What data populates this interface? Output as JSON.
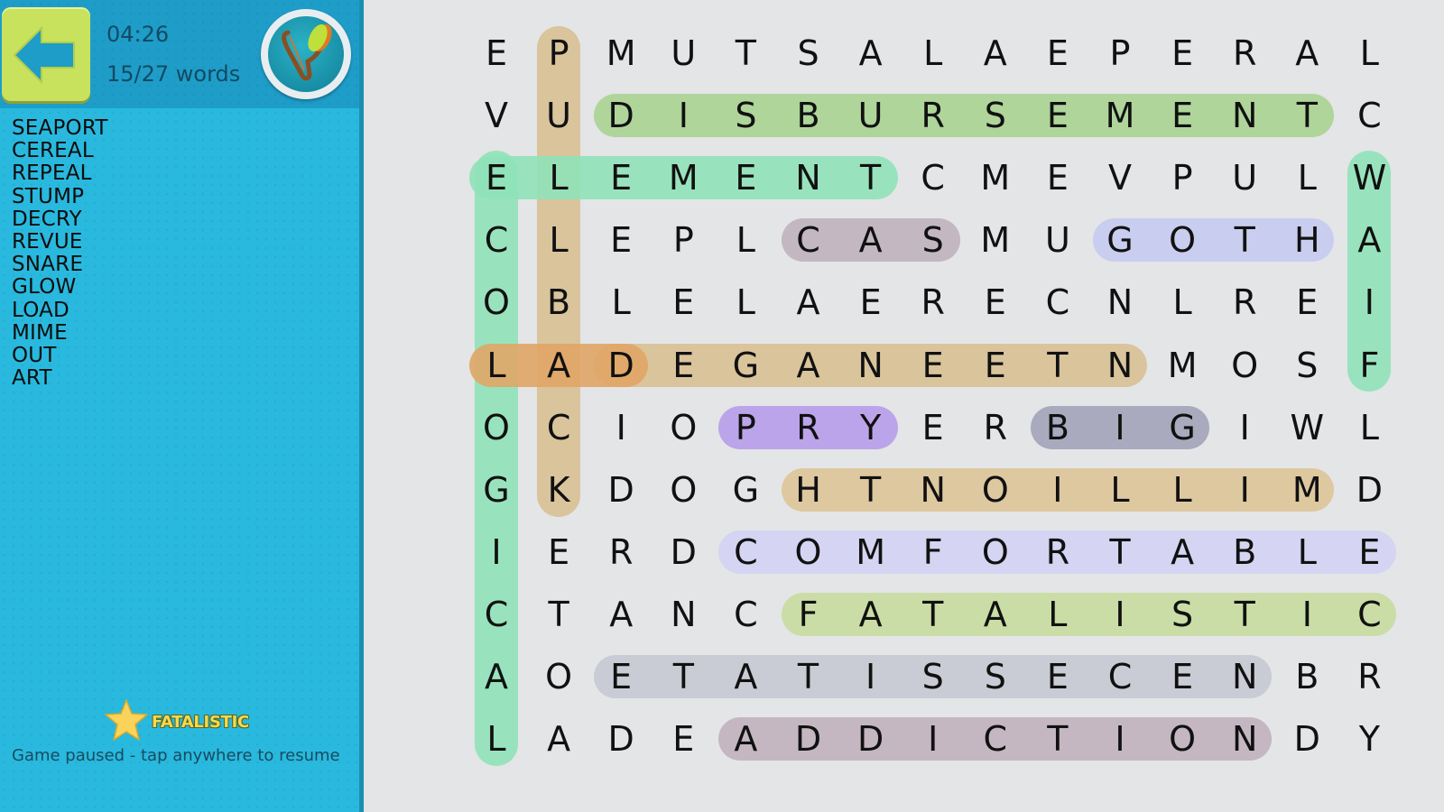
{
  "header": {
    "back_label": "Back",
    "timer": "04:26",
    "progress": "15/27 words",
    "badge_icon": "yoyo-icon"
  },
  "word_list": [
    "SEAPORT",
    "CEREAL",
    "REPEAL",
    "STUMP",
    "DECRY",
    "REVUE",
    "SNARE",
    "GLOW",
    "LOAD",
    "MIME",
    "OUT",
    "ART"
  ],
  "last_found": {
    "icon": "star-icon",
    "word": "FATALISTIC"
  },
  "status": "Game paused - tap anywhere to resume",
  "grid": [
    "EPMUTSALAEPERAL",
    "VUDISBURSEMENTC",
    "ELEMENTCMEVPULW",
    "CLEPLCASMUGOTHA",
    "OBLELAERECNLREI",
    "LADEGANEETNMOSF",
    "OCIOPRYERBIGIWL",
    "GKDOGHTNOILLIMD",
    "IERDCOMFORTABLE",
    "CTANCFATALISTIC",
    "AOETATISSECENBR",
    "LADEADDICTIONDY"
  ],
  "found": [
    {
      "word": "PULLBACK",
      "dir": "v",
      "col": 1,
      "start": 0,
      "end": 7,
      "color": "#d8c094"
    },
    {
      "word": "DISBURSEMENT",
      "dir": "h",
      "row": 1,
      "start": 2,
      "end": 13,
      "color": "#a8d391"
    },
    {
      "word": "ECOLOGICAL",
      "dir": "v",
      "col": 0,
      "start": 2,
      "end": 11,
      "color": "#8fe2b8"
    },
    {
      "word": "ELEMENT",
      "dir": "h",
      "row": 2,
      "start": 0,
      "end": 6,
      "color": "#8fe2b8"
    },
    {
      "word": "WAIF",
      "dir": "v",
      "col": 14,
      "start": 2,
      "end": 5,
      "color": "#8fe2b8"
    },
    {
      "word": "SAC",
      "dir": "h",
      "row": 3,
      "start": 5,
      "end": 7,
      "color": "#bfb1bd"
    },
    {
      "word": "GOTH",
      "dir": "h",
      "row": 3,
      "start": 10,
      "end": 13,
      "color": "#c5caef"
    },
    {
      "word": "TEENAGED",
      "dir": "h",
      "row": 5,
      "start": 2,
      "end": 10,
      "color": "#d8c094"
    },
    {
      "word": "LAD",
      "dir": "h",
      "row": 5,
      "start": 0,
      "end": 2,
      "color": "#e0a566"
    },
    {
      "word": "PRY",
      "dir": "h",
      "row": 6,
      "start": 4,
      "end": 6,
      "color": "#b69ce9"
    },
    {
      "word": "BIG",
      "dir": "h",
      "row": 6,
      "start": 9,
      "end": 11,
      "color": "#a2a3b8"
    },
    {
      "word": "MILLIONTH",
      "dir": "h",
      "row": 7,
      "start": 5,
      "end": 13,
      "color": "#dbc498"
    },
    {
      "word": "COMFORTABLE",
      "dir": "h",
      "row": 8,
      "start": 4,
      "end": 14,
      "color": "#d3d1f4"
    },
    {
      "word": "FATALISTIC",
      "dir": "h",
      "row": 9,
      "start": 5,
      "end": 14,
      "color": "#c6db9e"
    },
    {
      "word": "NECESSITATE",
      "dir": "h",
      "row": 10,
      "start": 2,
      "end": 12,
      "color": "#c5c9d2"
    },
    {
      "word": "ADDICTION",
      "dir": "h",
      "row": 11,
      "start": 4,
      "end": 12,
      "color": "#c0b1bc"
    }
  ]
}
